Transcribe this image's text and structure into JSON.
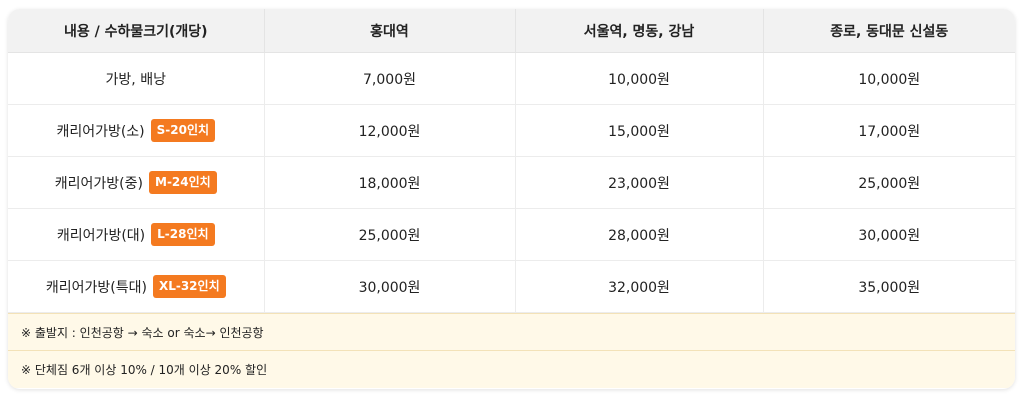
{
  "headers": [
    "내용 / 수하물크기(개당)",
    "홍대역",
    "서울역, 명동, 강남",
    "종로, 동대문 신설동"
  ],
  "rows": [
    {
      "item": "가방, 배낭",
      "badge": "",
      "prices": [
        "7,000원",
        "10,000원",
        "10,000원"
      ]
    },
    {
      "item": "캐리어가방(소)",
      "badge": "S-20인치",
      "prices": [
        "12,000원",
        "15,000원",
        "17,000원"
      ]
    },
    {
      "item": "캐리어가방(중)",
      "badge": "M-24인치",
      "prices": [
        "18,000원",
        "23,000원",
        "25,000원"
      ]
    },
    {
      "item": "캐리어가방(대)",
      "badge": "L-28인치",
      "prices": [
        "25,000원",
        "28,000원",
        "30,000원"
      ]
    },
    {
      "item": "캐리어가방(특대)",
      "badge": "XL-32인치",
      "prices": [
        "30,000원",
        "32,000원",
        "35,000원"
      ]
    }
  ],
  "notes": [
    "※ 출발지 : 인천공항 → 숙소 or 숙소→ 인천공항",
    "※ 단체짐 6개 이상 10% / 10개 이상 20% 할인"
  ],
  "colors": {
    "badge": "#f47a20",
    "header_bg": "#f2f2f2",
    "note_bg": "#fff9e8"
  }
}
